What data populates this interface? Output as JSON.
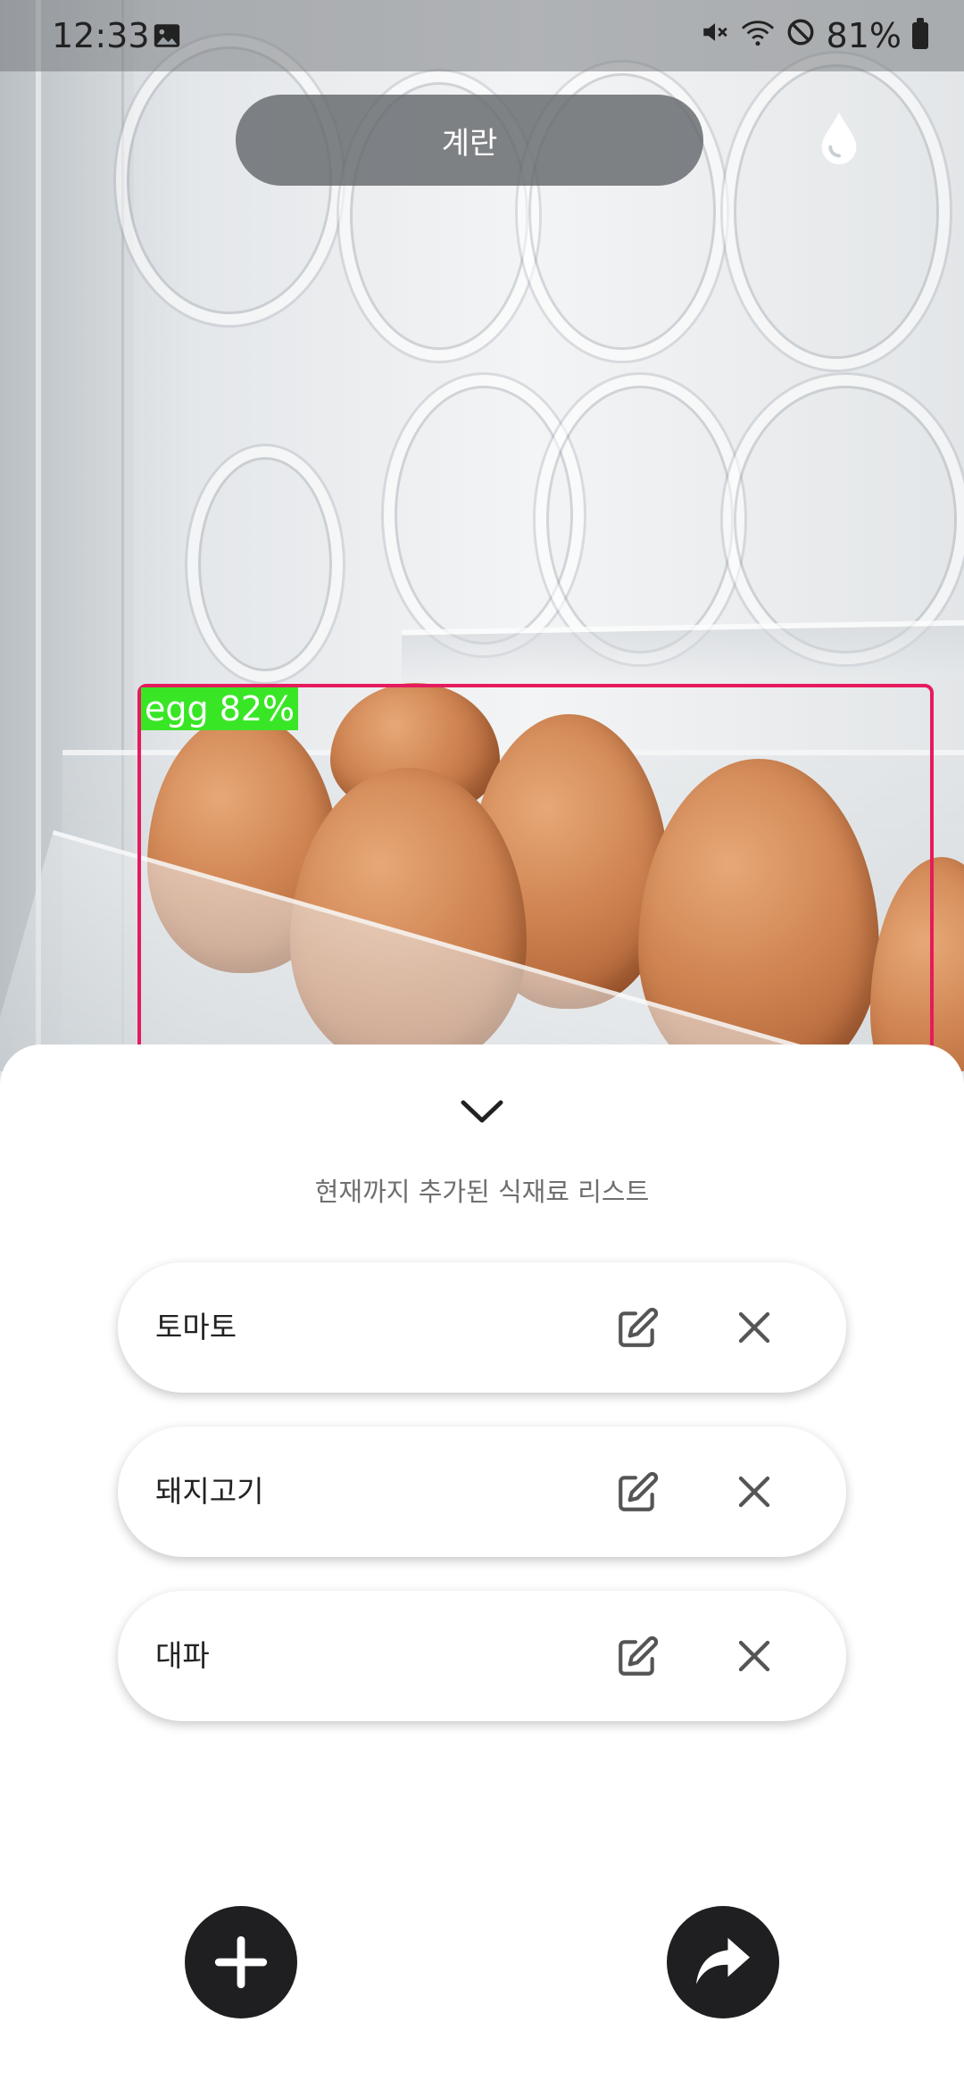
{
  "status_bar": {
    "time": "12:33",
    "battery": "81%",
    "icons": [
      "image-icon",
      "mute-icon",
      "wifi-icon",
      "do-not-disturb-icon",
      "battery-icon"
    ]
  },
  "detection": {
    "label": "egg 82%",
    "box_color": "#e51b5e",
    "label_bg": "#39e626"
  },
  "top_bar": {
    "selected_label": "계란",
    "drop_icon": "water-drop-icon"
  },
  "sheet": {
    "title": "현재까지 추가된 식재료 리스트",
    "items": [
      {
        "name": "토마토"
      },
      {
        "name": "돼지고기"
      },
      {
        "name": "대파"
      }
    ]
  },
  "actions": {
    "add_icon": "plus-icon",
    "share_icon": "forward-arrow-icon",
    "button_color": "#1f1f21"
  }
}
